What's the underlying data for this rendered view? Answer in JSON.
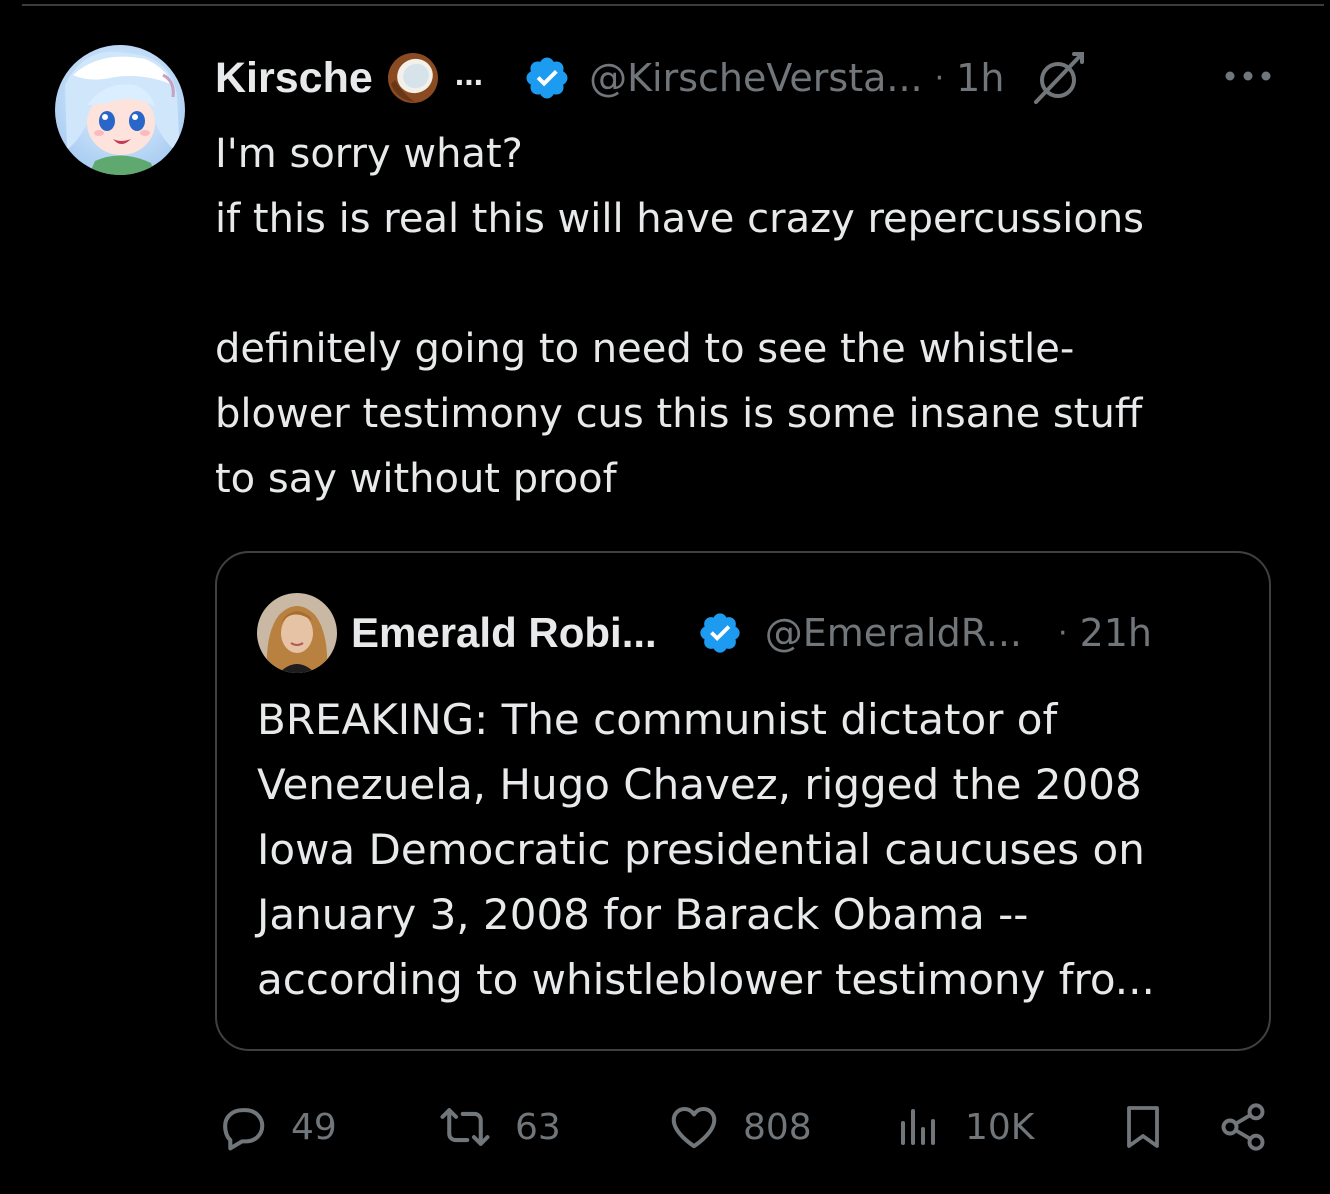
{
  "tweet": {
    "author": {
      "display_name": "Kirsche",
      "name_truncation": "...",
      "handle": "@KirscheVersta...",
      "emoji_icon": "coconut-icon",
      "verified_icon": "verified-badge-icon"
    },
    "separator": "·",
    "time": "1h",
    "text_lines": [
      "I'm sorry what?",
      "if this is real this will have crazy repercussions",
      "",
      "definitely going to need to see the whistle-",
      "blower testimony cus this is some insane stuff",
      "to say without proof"
    ],
    "quoted": {
      "display_name": "Emerald Robi...",
      "handle": "@EmeraldR...",
      "separator": "·",
      "time": "21h",
      "verified_icon": "verified-badge-icon",
      "text_lines": [
        "BREAKING: The communist dictator of",
        "Venezuela, Hugo Chavez, rigged the 2008",
        "Iowa Democratic presidential caucuses on",
        "January 3, 2008 for Barack Obama --",
        "according to whistleblower testimony fro..."
      ]
    },
    "actions": {
      "replies": "49",
      "reposts": "63",
      "likes": "808",
      "views": "10K"
    }
  },
  "colors": {
    "background": "#000000",
    "text": "#e7e9ea",
    "muted": "#71767b",
    "verified": "#1d9bf0",
    "border": "#3e4144"
  }
}
